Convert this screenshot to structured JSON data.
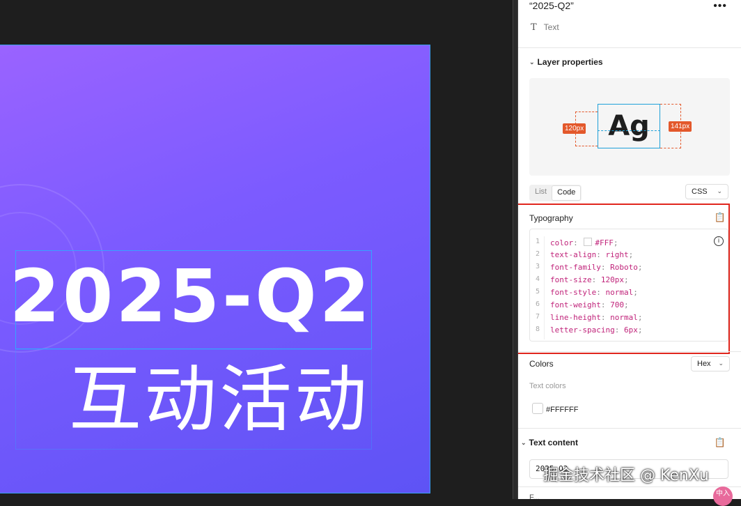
{
  "canvas": {
    "title_line1": "2025-Q2",
    "title_line2": "互动活动"
  },
  "panel": {
    "layer_name": "“2025-Q2”",
    "more_icon": "ellipsis-icon",
    "layer_type": "Text",
    "layer_type_icon": "T",
    "layer_properties": {
      "title": "Layer properties",
      "preview_glyph": "Ag",
      "left_label": "120px",
      "right_label": "141px"
    },
    "view_tabs": [
      "List",
      "Code"
    ],
    "active_tab": "Code",
    "lang_select": "CSS",
    "typography": {
      "title": "Typography",
      "line_numbers": [
        "1",
        "2",
        "3",
        "4",
        "5",
        "6",
        "7",
        "8"
      ],
      "lines": [
        {
          "prop": "color",
          "value": "#FFF",
          "swatch": true
        },
        {
          "prop": "text-align",
          "value": "right"
        },
        {
          "prop": "font-family",
          "value": "Roboto"
        },
        {
          "prop": "font-size",
          "value": "120px"
        },
        {
          "prop": "font-style",
          "value": "normal"
        },
        {
          "prop": "font-weight",
          "value": "700"
        },
        {
          "prop": "line-height",
          "value": "normal"
        },
        {
          "prop": "letter-spacing",
          "value": "6px"
        }
      ]
    },
    "colors": {
      "title": "Colors",
      "format_select": "Hex",
      "subtitle": "Text colors",
      "values": [
        "#FFFFFF"
      ]
    },
    "text_content": {
      "title": "Text content",
      "value": "2025-Q2"
    },
    "bottom_label": "F..."
  },
  "watermark": "掘金技术社区 @ KenXu",
  "avatar_text": "中入",
  "accent_color": "#e0261d",
  "selection_color": "#35a3ff"
}
